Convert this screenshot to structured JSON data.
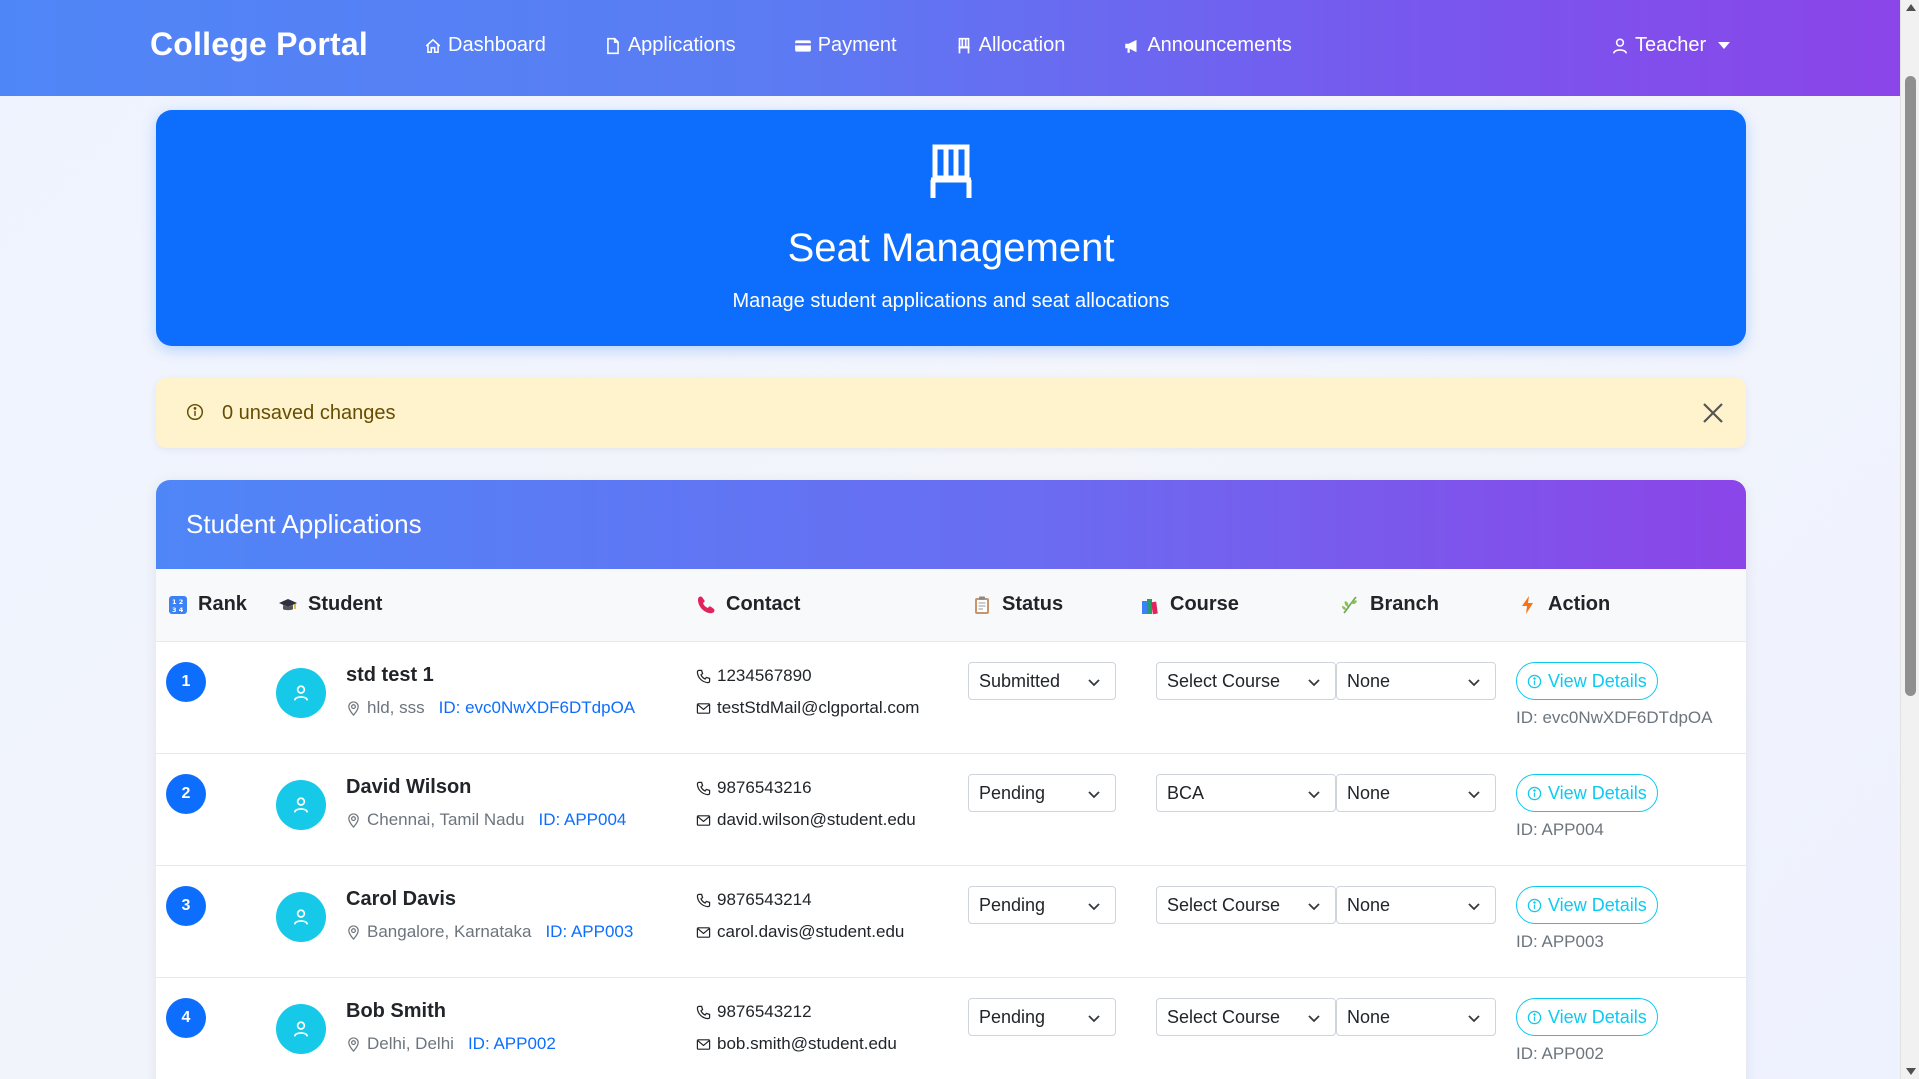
{
  "navbar": {
    "brand": "College Portal",
    "links": [
      {
        "label": "Dashboard",
        "icon": "house-icon"
      },
      {
        "label": "Applications",
        "icon": "file-icon"
      },
      {
        "label": "Payment",
        "icon": "credit-card-icon"
      },
      {
        "label": "Allocation",
        "icon": "chair-icon"
      },
      {
        "label": "Announcements",
        "icon": "megaphone-icon"
      }
    ],
    "user": "Teacher"
  },
  "hero": {
    "title": "Seat Management",
    "subtitle": "Manage student applications and seat allocations"
  },
  "alert": {
    "text": "0 unsaved changes"
  },
  "table": {
    "title": "Student Applications",
    "headers": {
      "rank": "Rank",
      "student": "Student",
      "contact": "Contact",
      "status": "Status",
      "course": "Course",
      "branch": "Branch",
      "action": "Action"
    },
    "view_label": "View Details",
    "rows": [
      {
        "rank": "1",
        "name": "std test 1",
        "location": "hld, sss",
        "id_label": "ID: evc0NwXDF6DTdpOA",
        "phone": "1234567890",
        "email": "testStdMail@clgportal.com",
        "status": "Submitted",
        "course": "Select Course",
        "branch": "None",
        "action_id": "ID: evc0NwXDF6DTdpOA"
      },
      {
        "rank": "2",
        "name": "David Wilson",
        "location": "Chennai, Tamil Nadu",
        "id_label": "ID: APP004",
        "phone": "9876543216",
        "email": "david.wilson@student.edu",
        "status": "Pending",
        "course": "BCA",
        "branch": "None",
        "action_id": "ID: APP004"
      },
      {
        "rank": "3",
        "name": "Carol Davis",
        "location": "Bangalore, Karnataka",
        "id_label": "ID: APP003",
        "phone": "9876543214",
        "email": "carol.davis@student.edu",
        "status": "Pending",
        "course": "Select Course",
        "branch": "None",
        "action_id": "ID: APP003"
      },
      {
        "rank": "4",
        "name": "Bob Smith",
        "location": "Delhi, Delhi",
        "id_label": "ID: APP002",
        "phone": "9876543212",
        "email": "bob.smith@student.edu",
        "status": "Pending",
        "course": "Select Course",
        "branch": "None",
        "action_id": "ID: APP002"
      }
    ]
  },
  "colors": {
    "primary": "#0d6efd",
    "info": "#0dcaf0",
    "avatar": "#17c9e8",
    "alert_bg": "#fff3cd",
    "nav_start": "#4f86f7",
    "nav_end": "#8b45e8"
  }
}
